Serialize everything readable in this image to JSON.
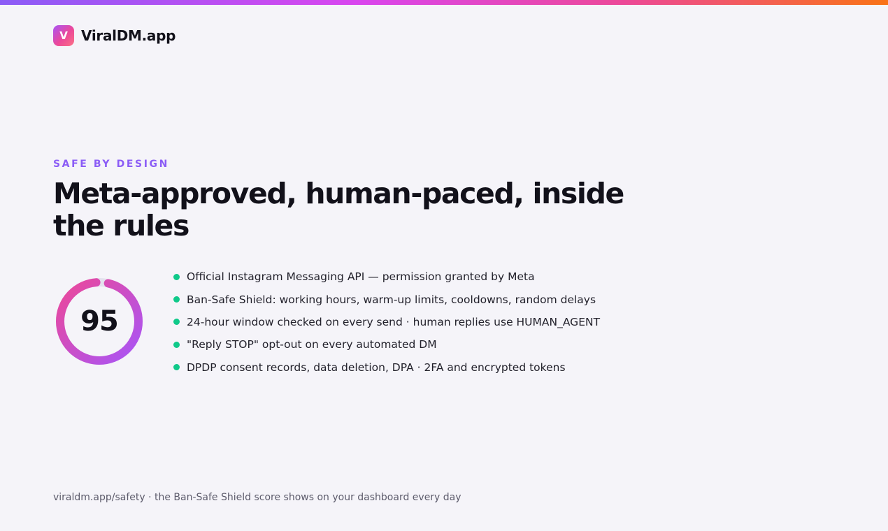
{
  "brand": {
    "logo_letter": "V",
    "name": "ViralDM.app"
  },
  "hero": {
    "eyebrow": "SAFE BY DESIGN",
    "headline": "Meta-approved, human-paced, inside the rules"
  },
  "score": {
    "value": "95",
    "fraction": 0.95,
    "ring_colors": [
      "#ec4899",
      "#a855f7"
    ],
    "track_color": "#e4e1ee"
  },
  "features": [
    "Official Instagram Messaging API — permission granted by Meta",
    "Ban-Safe Shield: working hours, warm-up limits, cooldowns, random delays",
    "24-hour window checked on every send · human replies use HUMAN_AGENT",
    "\"Reply STOP\" opt-out on every automated DM",
    "DPDP consent records, data deletion, DPA · 2FA and encrypted tokens"
  ],
  "footer": {
    "note": "viraldm.app/safety · the Ban-Safe Shield score shows on your dashboard every day"
  },
  "colors": {
    "accent": "#8b5cf6",
    "bullet": "#10c98a",
    "background": "#f5f4f9"
  }
}
